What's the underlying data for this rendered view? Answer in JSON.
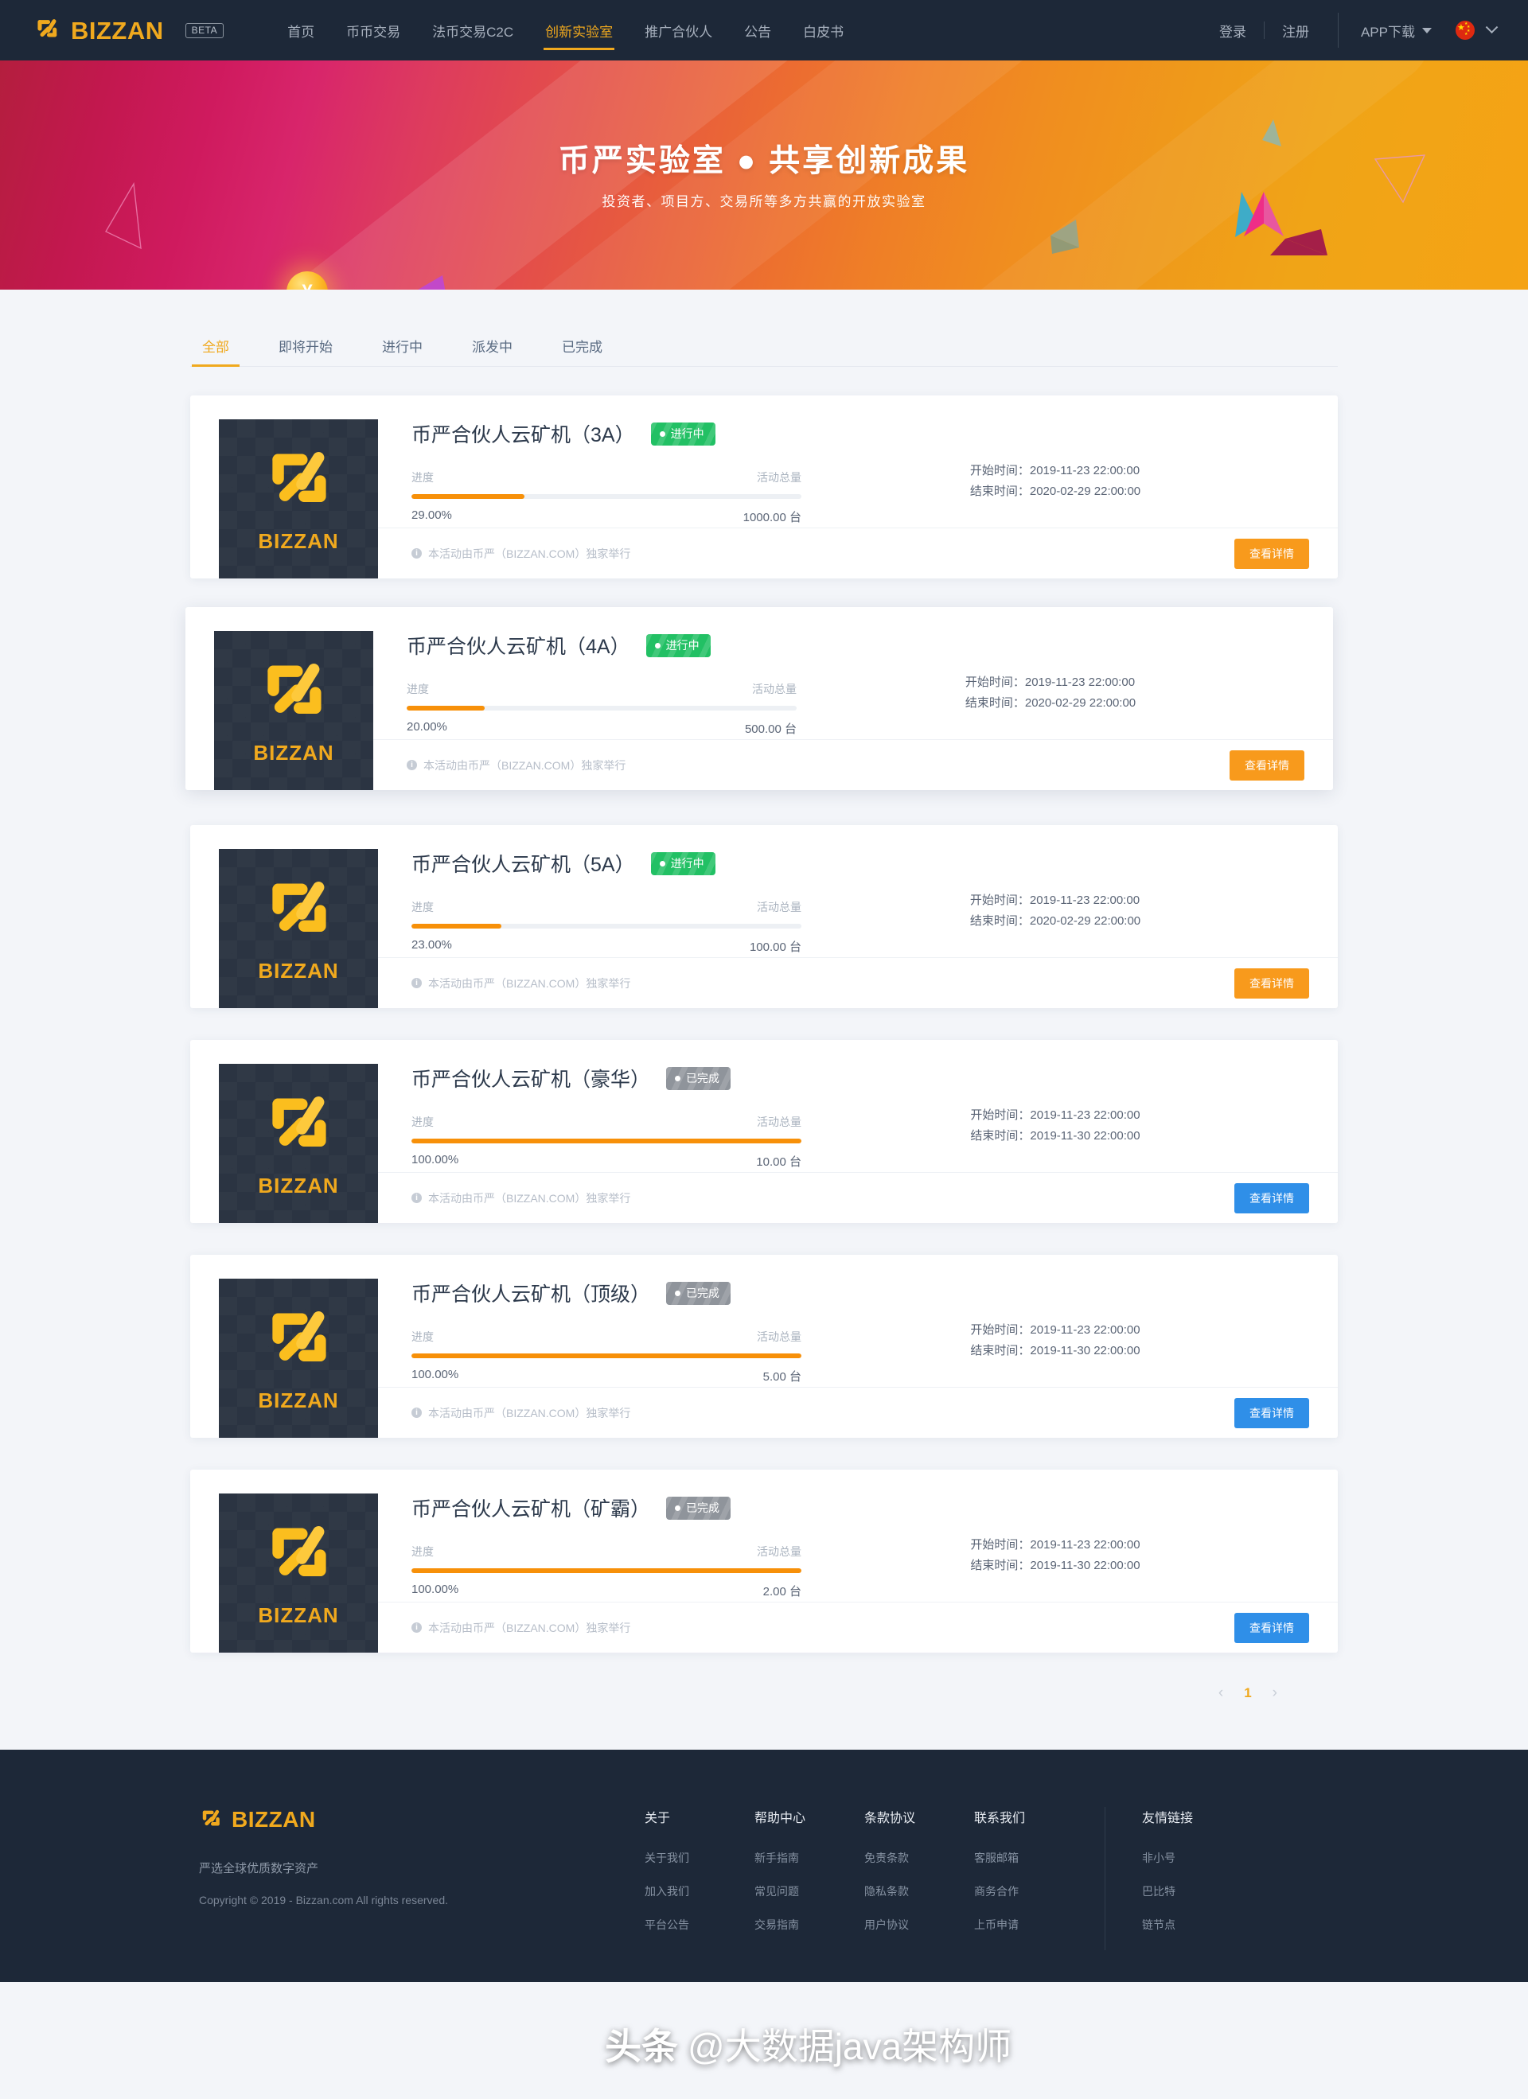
{
  "header": {
    "brand": "BIZZAN",
    "beta": "BETA",
    "nav": [
      {
        "label": "首页",
        "active": false
      },
      {
        "label": "币币交易",
        "active": false
      },
      {
        "label": "法币交易C2C",
        "active": false
      },
      {
        "label": "创新实验室",
        "active": true
      },
      {
        "label": "推广合伙人",
        "active": false
      },
      {
        "label": "公告",
        "active": false
      },
      {
        "label": "白皮书",
        "active": false
      }
    ],
    "login": "登录",
    "register": "注册",
    "app_download": "APP下载",
    "language_flag": "cn-flag-icon"
  },
  "hero": {
    "title": "币严实验室  ●  共享创新成果",
    "subtitle": "投资者、项目方、交易所等多方共赢的开放实验室"
  },
  "tabs": [
    {
      "label": "全部",
      "active": true
    },
    {
      "label": "即将开始",
      "active": false
    },
    {
      "label": "进行中",
      "active": false
    },
    {
      "label": "派发中",
      "active": false
    },
    {
      "label": "已完成",
      "active": false
    }
  ],
  "card_labels": {
    "progress": "进度",
    "total": "活动总量",
    "start_time": "开始时间：",
    "end_time": "结束时间：",
    "disclaimer": "本活动由币严（BIZZAN.COM）独家举行",
    "detail_button": "查看详情",
    "thumb_text": "BIZZAN"
  },
  "cards": [
    {
      "title": "币严合伙人云矿机（3A）",
      "status": "进行中",
      "status_type": "running",
      "progress_pct": "29.00%",
      "progress_value": 29,
      "total": "1000.00 台",
      "start": "2019-11-23 22:00:00",
      "end": "2020-02-29 22:00:00",
      "button_color": "orange"
    },
    {
      "title": "币严合伙人云矿机（4A）",
      "status": "进行中",
      "status_type": "running",
      "progress_pct": "20.00%",
      "progress_value": 20,
      "total": "500.00 台",
      "start": "2019-11-23 22:00:00",
      "end": "2020-02-29 22:00:00",
      "button_color": "orange"
    },
    {
      "title": "币严合伙人云矿机（5A）",
      "status": "进行中",
      "status_type": "running",
      "progress_pct": "23.00%",
      "progress_value": 23,
      "total": "100.00 台",
      "start": "2019-11-23 22:00:00",
      "end": "2020-02-29 22:00:00",
      "button_color": "orange"
    },
    {
      "title": "币严合伙人云矿机（豪华）",
      "status": "已完成",
      "status_type": "done",
      "progress_pct": "100.00%",
      "progress_value": 100,
      "total": "10.00 台",
      "start": "2019-11-23 22:00:00",
      "end": "2019-11-30 22:00:00",
      "button_color": "blue"
    },
    {
      "title": "币严合伙人云矿机（顶级）",
      "status": "已完成",
      "status_type": "done",
      "progress_pct": "100.00%",
      "progress_value": 100,
      "total": "5.00 台",
      "start": "2019-11-23 22:00:00",
      "end": "2019-11-30 22:00:00",
      "button_color": "blue"
    },
    {
      "title": "币严合伙人云矿机（矿霸）",
      "status": "已完成",
      "status_type": "done",
      "progress_pct": "100.00%",
      "progress_value": 100,
      "total": "2.00 台",
      "start": "2019-11-23 22:00:00",
      "end": "2019-11-30 22:00:00",
      "button_color": "blue"
    }
  ],
  "pagination": {
    "prev": "‹",
    "page": "1",
    "next": "›"
  },
  "footer": {
    "brand": "BIZZAN",
    "slogan": "严选全球优质数字资产",
    "copyright": "Copyright © 2019 - Bizzan.com All rights reserved.",
    "columns": [
      {
        "title": "关于",
        "links": [
          "关于我们",
          "加入我们",
          "平台公告"
        ]
      },
      {
        "title": "帮助中心",
        "links": [
          "新手指南",
          "常见问题",
          "交易指南"
        ]
      },
      {
        "title": "条款协议",
        "links": [
          "免责条款",
          "隐私条款",
          "用户协议"
        ]
      },
      {
        "title": "联系我们",
        "links": [
          "客服邮箱",
          "商务合作",
          "上币申请"
        ]
      }
    ],
    "friend_column": {
      "title": "友情链接",
      "links": [
        "非小号",
        "巴比特",
        "链节点"
      ]
    }
  },
  "watermark": {
    "logo": "头条",
    "handle": "@大数据java架构师"
  }
}
